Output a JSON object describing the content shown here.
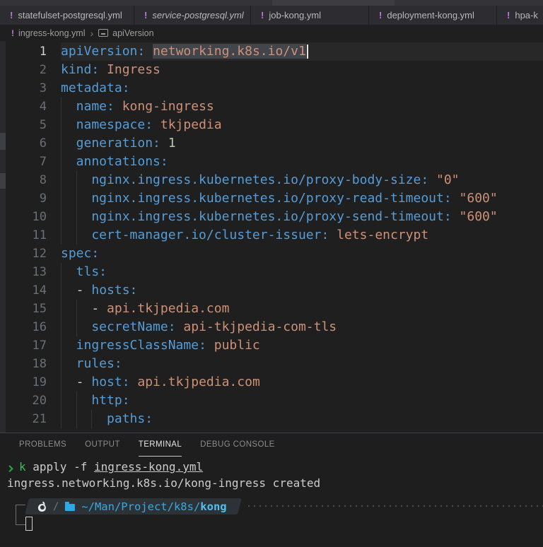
{
  "colors": {
    "yaml_icon_purple": "#c678dd",
    "key_blue": "#569cd6",
    "value_orange": "#ce9178",
    "number_green": "#b5cea8",
    "terminal_green": "#27a843",
    "path_blue": "#38a9e0",
    "editor_bg": "#1f1f1f",
    "tab_bg": "#2d2d31"
  },
  "tabs": [
    {
      "icon": "!",
      "label": "statefulset-postgresql.yml",
      "italic": false
    },
    {
      "icon": "!",
      "label": "service-postgresql.yml",
      "italic": true
    },
    {
      "icon": "!",
      "label": "job-kong.yml",
      "italic": false
    },
    {
      "icon": "!",
      "label": "deployment-kong.yml",
      "italic": false
    },
    {
      "icon": "!",
      "label": "hpa-k",
      "italic": false
    }
  ],
  "breadcrumb": {
    "file_icon": "!",
    "file": "ingress-kong.yml",
    "separator": "›",
    "symbol": "apiVersion"
  },
  "editor": {
    "lines": [
      {
        "n": "1",
        "g": 0,
        "highlight": true,
        "tokens": [
          {
            "t": "key",
            "v": "apiVersion:"
          },
          {
            "t": "plain",
            "v": " "
          },
          {
            "t": "sel",
            "v": "networking.k8s.io/v1"
          },
          {
            "t": "cursor",
            "v": ""
          }
        ]
      },
      {
        "n": "2",
        "g": 0,
        "tokens": [
          {
            "t": "key",
            "v": "kind:"
          },
          {
            "t": "val",
            "v": " Ingress"
          }
        ]
      },
      {
        "n": "3",
        "g": 0,
        "tokens": [
          {
            "t": "key",
            "v": "metadata:"
          }
        ]
      },
      {
        "n": "4",
        "g": 1,
        "tokens": [
          {
            "t": "key",
            "v": "name:"
          },
          {
            "t": "val",
            "v": " kong-ingress"
          }
        ]
      },
      {
        "n": "5",
        "g": 1,
        "tokens": [
          {
            "t": "key",
            "v": "namespace:"
          },
          {
            "t": "val",
            "v": " tkjpedia"
          }
        ]
      },
      {
        "n": "6",
        "g": 1,
        "tokens": [
          {
            "t": "key",
            "v": "generation:"
          },
          {
            "t": "num",
            "v": " 1"
          }
        ]
      },
      {
        "n": "7",
        "g": 1,
        "tokens": [
          {
            "t": "key",
            "v": "annotations:"
          }
        ]
      },
      {
        "n": "8",
        "g": 2,
        "tokens": [
          {
            "t": "key",
            "v": "nginx.ingress.kubernetes.io/proxy-body-size:"
          },
          {
            "t": "val",
            "v": " \"0\""
          }
        ]
      },
      {
        "n": "9",
        "g": 2,
        "tokens": [
          {
            "t": "key",
            "v": "nginx.ingress.kubernetes.io/proxy-read-timeout:"
          },
          {
            "t": "val",
            "v": " \"600\""
          }
        ]
      },
      {
        "n": "10",
        "g": 2,
        "tokens": [
          {
            "t": "key",
            "v": "nginx.ingress.kubernetes.io/proxy-send-timeout:"
          },
          {
            "t": "val",
            "v": " \"600\""
          }
        ]
      },
      {
        "n": "11",
        "g": 2,
        "tokens": [
          {
            "t": "key",
            "v": "cert-manager.io/cluster-issuer:"
          },
          {
            "t": "val",
            "v": " lets-encrypt"
          }
        ]
      },
      {
        "n": "12",
        "g": 0,
        "tokens": [
          {
            "t": "key",
            "v": "spec:"
          }
        ]
      },
      {
        "n": "13",
        "g": 1,
        "tokens": [
          {
            "t": "key",
            "v": "tls:"
          }
        ]
      },
      {
        "n": "14",
        "g": 1,
        "tokens": [
          {
            "t": "dash",
            "v": "- "
          },
          {
            "t": "key",
            "v": "hosts:"
          }
        ]
      },
      {
        "n": "15",
        "g": 2,
        "tokens": [
          {
            "t": "dash",
            "v": "- "
          },
          {
            "t": "val",
            "v": "api.tkjpedia.com"
          }
        ]
      },
      {
        "n": "16",
        "g": 2,
        "tokens": [
          {
            "t": "key",
            "v": "secretName:"
          },
          {
            "t": "val",
            "v": " api-tkjpedia-com-tls"
          }
        ]
      },
      {
        "n": "17",
        "g": 1,
        "tokens": [
          {
            "t": "key",
            "v": "ingressClassName:"
          },
          {
            "t": "val",
            "v": " public"
          }
        ]
      },
      {
        "n": "18",
        "g": 1,
        "tokens": [
          {
            "t": "key",
            "v": "rules:"
          }
        ]
      },
      {
        "n": "19",
        "g": 1,
        "tokens": [
          {
            "t": "dash",
            "v": "- "
          },
          {
            "t": "key",
            "v": "host:"
          },
          {
            "t": "val",
            "v": " api.tkjpedia.com"
          }
        ]
      },
      {
        "n": "20",
        "g": 2,
        "tokens": [
          {
            "t": "key",
            "v": "http:"
          }
        ]
      },
      {
        "n": "21",
        "g": 3,
        "tokens": [
          {
            "t": "key",
            "v": "paths:"
          }
        ]
      }
    ]
  },
  "panel": {
    "tabs": [
      {
        "label": "PROBLEMS",
        "active": false
      },
      {
        "label": "OUTPUT",
        "active": false
      },
      {
        "label": "TERMINAL",
        "active": true
      },
      {
        "label": "DEBUG CONSOLE",
        "active": false
      }
    ]
  },
  "terminal": {
    "prompt_symbol": "❯",
    "command": [
      {
        "t": "prompt",
        "v": "❯"
      },
      {
        "t": "cmd",
        "v": "k"
      },
      {
        "t": "plain",
        "v": " apply -f "
      },
      {
        "t": "file",
        "v": "ingress-kong.yml"
      }
    ],
    "output": "ingress.networking.k8s.io/kong-ingress created",
    "prompt_separator": "/",
    "prompt_path_prefix": "~/Man/Project/k8s/",
    "prompt_path_dir": "kong"
  }
}
